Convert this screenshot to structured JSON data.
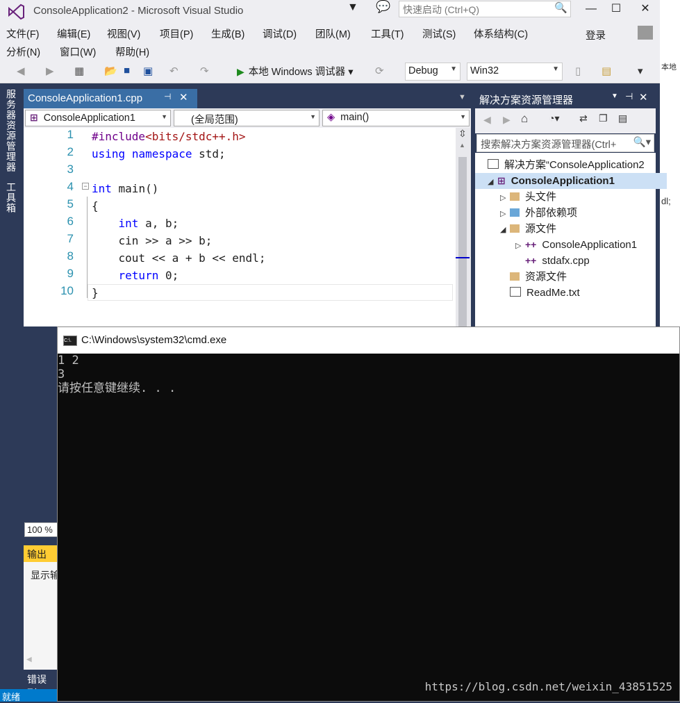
{
  "window": {
    "title": "ConsoleApplication2 - Microsoft Visual Studio",
    "quick_launch_placeholder": "快速启动 (Ctrl+Q)"
  },
  "menus": {
    "row1": [
      "文件(F)",
      "编辑(E)",
      "视图(V)",
      "项目(P)",
      "生成(B)",
      "调试(D)",
      "团队(M)",
      "工具(T)",
      "测试(S)",
      "体系结构(C)"
    ],
    "row2": [
      "分析(N)",
      "窗口(W)",
      "帮助(H)"
    ],
    "login": "登录"
  },
  "toolbar": {
    "run_label": "本地 Windows 调试器",
    "config": "Debug",
    "platform": "Win32",
    "right_edge": "本地"
  },
  "left_tabs": [
    "服务器资源管理器",
    "工具箱"
  ],
  "editor": {
    "tab_title": "ConsoleApplication1.cpp",
    "nav_project": "ConsoleApplication1",
    "nav_scope": "(全局范围)",
    "nav_member": "main()",
    "zoom": "100 %",
    "line_numbers": [
      "1",
      "2",
      "3",
      "4",
      "5",
      "6",
      "7",
      "8",
      "9",
      "10"
    ]
  },
  "solution_explorer": {
    "title": "解决方案资源管理器",
    "search_placeholder": "搜索解决方案资源管理器(Ctrl+",
    "items": [
      "解决方案“ConsoleApplication2",
      "ConsoleApplication1",
      "头文件",
      "外部依赖项",
      "源文件",
      "ConsoleApplication1",
      "stdafx.cpp",
      "资源文件",
      "ReadMe.txt"
    ]
  },
  "output": {
    "tab": "输出",
    "show_label": "显示输",
    "error_list": "错误列",
    "status": "就绪"
  },
  "cmd": {
    "title": "C:\\Windows\\system32\\cmd.exe",
    "lines": [
      "1 2",
      "3",
      "请按任意键继续. . ."
    ],
    "icon_text": "C:\\."
  },
  "watermark": "https://blog.csdn.net/weixin_43851525",
  "side_snippet": "dl;",
  "colors": {
    "accent": "#007acc",
    "ide_dark": "#2d3a58",
    "tab_active": "#3a6ea5",
    "keyword": "#0000ff",
    "string": "#a31515",
    "line_number": "#2b91af"
  }
}
